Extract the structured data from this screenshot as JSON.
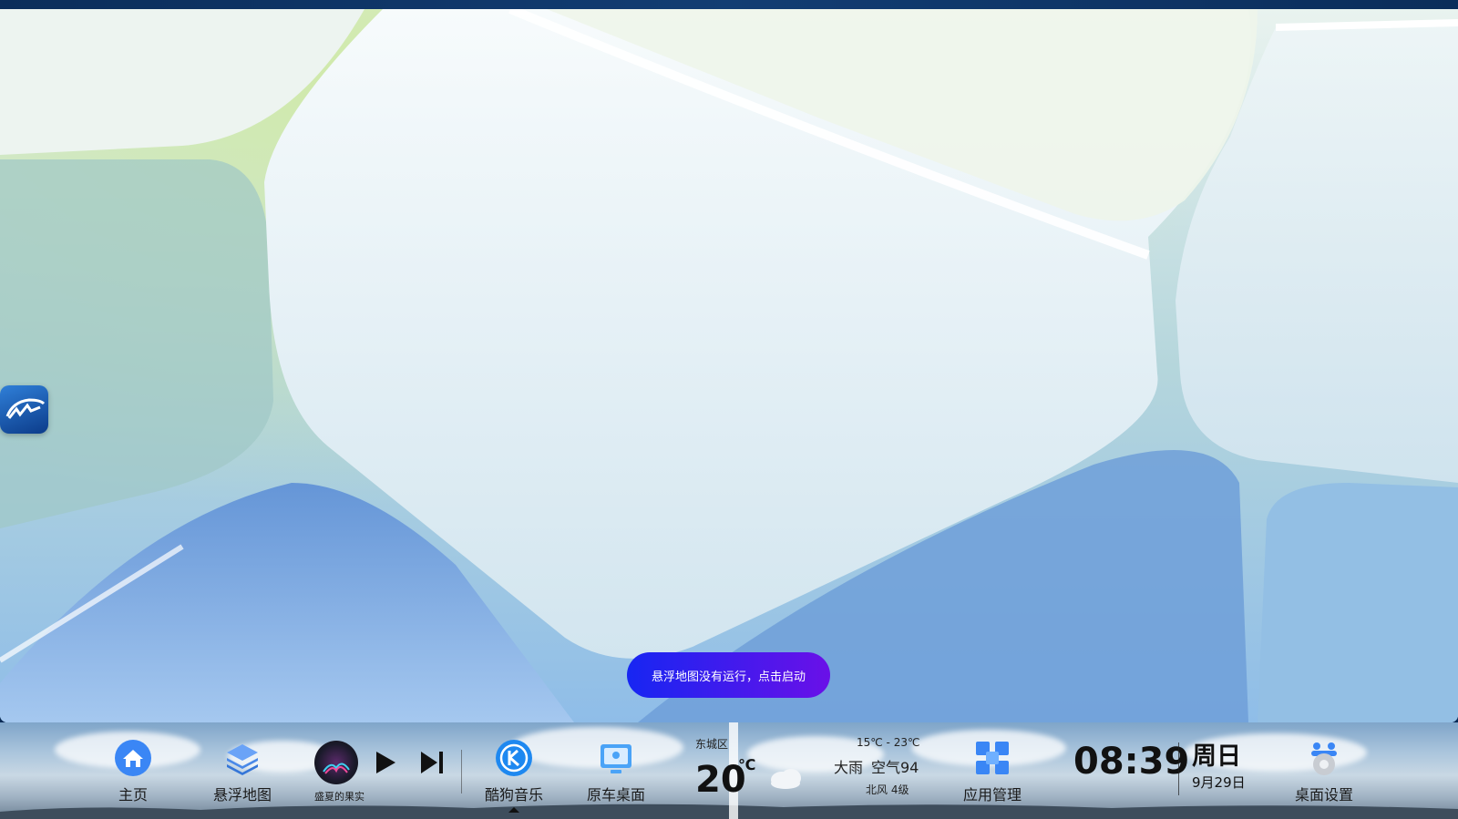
{
  "floating_button": {
    "icon": "float-map-app-icon"
  },
  "toast": {
    "text": "悬浮地图没有运行，点击启动"
  },
  "dock": {
    "home": {
      "label": "主页",
      "icon": "home-icon"
    },
    "float_map": {
      "label": "悬浮地图",
      "icon": "layers-icon"
    },
    "music_player": {
      "song": "盛夏的果实",
      "play_icon": "play-icon",
      "next_icon": "skip-next-icon"
    },
    "kugou": {
      "label": "酷狗音乐",
      "icon": "kugou-k-icon"
    },
    "original_desktop": {
      "label": "原车桌面",
      "icon": "car-screen-icon"
    },
    "weather": {
      "district": "东城区",
      "temp": "20",
      "unit": "℃",
      "range": "15℃ - 23℃",
      "condition": "大雨",
      "aqi": "空气94",
      "wind": "北风  4级",
      "icon": "cloud-rain-icon"
    },
    "app_manager": {
      "label": "应用管理",
      "icon": "app-grid-icon"
    },
    "clock": {
      "time": "08:39",
      "weekday": "周日",
      "date": "9月29日"
    },
    "desktop_settings": {
      "label": "桌面设置",
      "icon": "settings-gear-icon"
    }
  },
  "colors": {
    "toast_start": "#1726f2",
    "toast_end": "#6a10e8",
    "accent_blue": "#3a86f5"
  }
}
